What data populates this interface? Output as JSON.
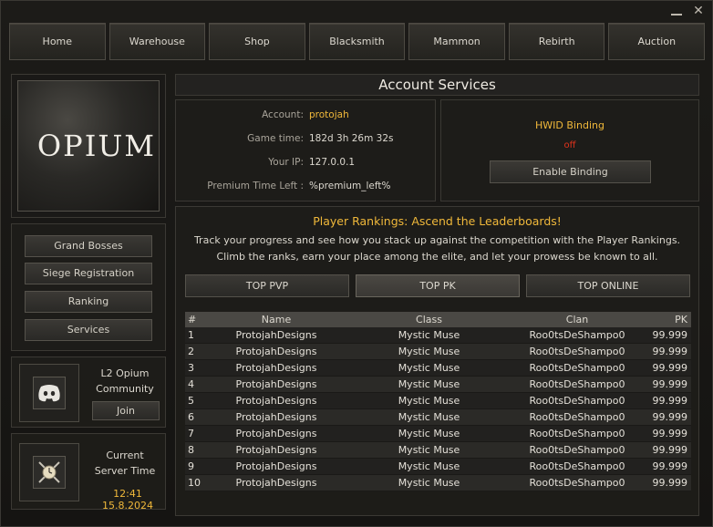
{
  "nav": [
    "Home",
    "Warehouse",
    "Shop",
    "Blacksmith",
    "Mammon",
    "Rebirth",
    "Auction"
  ],
  "logo": {
    "text": "OPIUM"
  },
  "sidebar": {
    "items": [
      "Grand Bosses",
      "Siege Registration",
      "Ranking",
      "Services"
    ]
  },
  "community": {
    "line1": "L2 Opium",
    "line2": "Community",
    "join_label": "Join",
    "icon": "discord-icon"
  },
  "server_time": {
    "line1": "Current",
    "line2": "Server Time",
    "value": "12:41 15.8.2024",
    "icon": "clock-swords-icon"
  },
  "page_title": "Account Services",
  "account": {
    "account_label": "Account:",
    "account_value": "protojah",
    "game_time_label": "Game time:",
    "game_time_value": "182d 3h 26m 32s",
    "ip_label": "Your IP:",
    "ip_value": "127.0.0.1",
    "premium_label": "Premium Time Left :",
    "premium_value": "%premium_left%"
  },
  "hwid": {
    "title": "HWID Binding",
    "status": "off",
    "button_label": "Enable Binding"
  },
  "rankings": {
    "heading": "Player Rankings: Ascend the Leaderboards!",
    "desc1": "Track your progress and see how you stack up against the competition with the Player Rankings.",
    "desc2": "Climb the ranks, earn your place among the elite, and let your prowess be known to all.",
    "tabs": [
      "TOP PVP",
      "TOP PK",
      "TOP ONLINE"
    ],
    "active_tab": "TOP PK",
    "columns": [
      "#",
      "Name",
      "Class",
      "Clan",
      "PK"
    ],
    "rows": [
      [
        "1",
        "ProtojahDesigns",
        "Mystic Muse",
        "Roo0tsDeShampo0",
        "99.999"
      ],
      [
        "2",
        "ProtojahDesigns",
        "Mystic Muse",
        "Roo0tsDeShampo0",
        "99.999"
      ],
      [
        "3",
        "ProtojahDesigns",
        "Mystic Muse",
        "Roo0tsDeShampo0",
        "99.999"
      ],
      [
        "4",
        "ProtojahDesigns",
        "Mystic Muse",
        "Roo0tsDeShampo0",
        "99.999"
      ],
      [
        "5",
        "ProtojahDesigns",
        "Mystic Muse",
        "Roo0tsDeShampo0",
        "99.999"
      ],
      [
        "6",
        "ProtojahDesigns",
        "Mystic Muse",
        "Roo0tsDeShampo0",
        "99.999"
      ],
      [
        "7",
        "ProtojahDesigns",
        "Mystic Muse",
        "Roo0tsDeShampo0",
        "99.999"
      ],
      [
        "8",
        "ProtojahDesigns",
        "Mystic Muse",
        "Roo0tsDeShampo0",
        "99.999"
      ],
      [
        "9",
        "ProtojahDesigns",
        "Mystic Muse",
        "Roo0tsDeShampo0",
        "99.999"
      ],
      [
        "10",
        "ProtojahDesigns",
        "Mystic Muse",
        "Roo0tsDeShampo0",
        "99.999"
      ]
    ]
  },
  "colors": {
    "accent": "#f0b83a",
    "status_off": "#e0331c"
  }
}
